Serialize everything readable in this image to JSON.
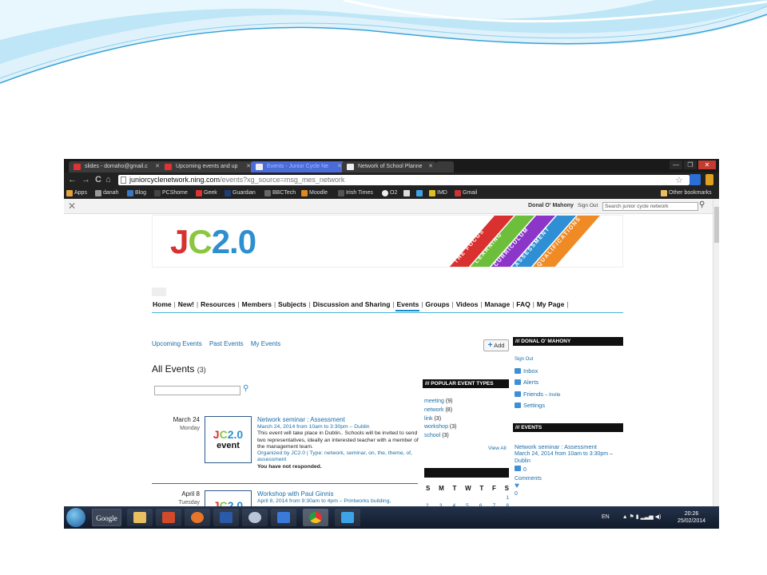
{
  "browser": {
    "tabs": [
      {
        "label": "slides - domaho@gmail.c",
        "active": false,
        "icon": "gmail-icon"
      },
      {
        "label": "Upcoming events and up",
        "active": false,
        "icon": "gmail-icon"
      },
      {
        "label": "Events - Junior Cycle Ne",
        "active": true,
        "icon": "page-icon"
      },
      {
        "label": "Network of School Planne",
        "active": false,
        "icon": "page-icon"
      }
    ],
    "window_buttons": [
      "—",
      "❐",
      "✕"
    ],
    "url_host": "juniorcyclenetwork.ning.com",
    "url_path": "/events?xg_source=msg_mes_network",
    "bookmarks": [
      "Apps",
      "danah",
      "Blog",
      "PCShome",
      "Geek",
      "Guardian",
      "BBCTech",
      "Moodle",
      "Irish Times",
      "O2",
      "",
      "",
      "IMD",
      "Gmail"
    ],
    "other_bookmarks": "Other bookmarks"
  },
  "ning_bar": {
    "user_name": "Donal O' Mahony",
    "sign_out": "Sign Out",
    "search_placeholder": "Search junior cycle network"
  },
  "site": {
    "logo": {
      "j": "J",
      "c": "C",
      "rest": "2.0"
    },
    "banner_stripes": [
      "THE FOCUS",
      "LEARNING",
      "CURRICULUM",
      "ASSESSMENT",
      "QUALIFICATIONS"
    ],
    "nav": [
      "Home",
      "New!",
      "Resources",
      "Members",
      "Subjects",
      "Discussion and Sharing",
      "Events",
      "Groups",
      "Videos",
      "Manage",
      "FAQ",
      "My Page"
    ],
    "active_nav": "Events",
    "sub_links": [
      "Upcoming Events",
      "Past Events",
      "My Events"
    ],
    "add_button": "Add",
    "all_events_title": "All Events",
    "all_events_count": "(3)"
  },
  "events": [
    {
      "date": "March 24",
      "dow": "Monday",
      "thumb_title": "JC2.0",
      "thumb_sub": "event",
      "title": "Network seminar : Assessment",
      "when": "March 24, 2014 from 10am to 3:30pm – Dublin",
      "desc": "This event will take place in Dublin.. Schools will be invited to send two representatives, ideally an interested teacher with a member of the management team.",
      "organized": "Organized by JC2.0 | Type: network, seminar, on, the, theme, of, assessment",
      "rsvp": "You have not responded."
    },
    {
      "date": "April 8",
      "dow": "Tuesday",
      "thumb_title": "JC2.0",
      "thumb_sub": "",
      "title": "Workshop with Paul Ginnis",
      "when": "April 8, 2014 from 9:30am to 4pm – Printworks building,",
      "desc": "",
      "organized": "",
      "rsvp": ""
    }
  ],
  "popular": {
    "title": "/// POPULAR EVENT TYPES",
    "items": [
      {
        "label": "meeting",
        "count": "(9)"
      },
      {
        "label": "network",
        "count": "(8)"
      },
      {
        "label": "link",
        "count": "(3)"
      },
      {
        "label": "workshop",
        "count": "(3)"
      },
      {
        "label": "school",
        "count": "(3)"
      }
    ],
    "view_all": "View All"
  },
  "calendar": {
    "days": [
      "S",
      "M",
      "T",
      "W",
      "T",
      "F",
      "S"
    ],
    "first_row": [
      "2",
      "3",
      "4",
      "5",
      "6",
      "7",
      "8"
    ],
    "top_num": "1"
  },
  "profile": {
    "title": "/// DONAL O' MAHONY",
    "sign_out": "Sign Out",
    "inbox": "Inbox",
    "alerts": "Alerts",
    "friends": "Friends",
    "invite": "– Invite",
    "settings": "Settings"
  },
  "right_events": {
    "title": "/// EVENTS",
    "event_title": "Network seminar : Assessment",
    "event_when": "March 24, 2014 from 10am to 3:30pm –",
    "event_place": "Dublin",
    "comment_count": "0",
    "comments_label": "Comments",
    "likes_count": "0"
  },
  "taskbar": {
    "google_label": "Google",
    "lang": "EN",
    "time": "20:26",
    "date": "25/02/2014"
  },
  "colors": {
    "logo_j": "#d6322f",
    "logo_c": "#8cc63f",
    "logo_rest": "#2e8fd0",
    "nav_accent": "#4ab0d9",
    "link": "#1a6ea8"
  }
}
